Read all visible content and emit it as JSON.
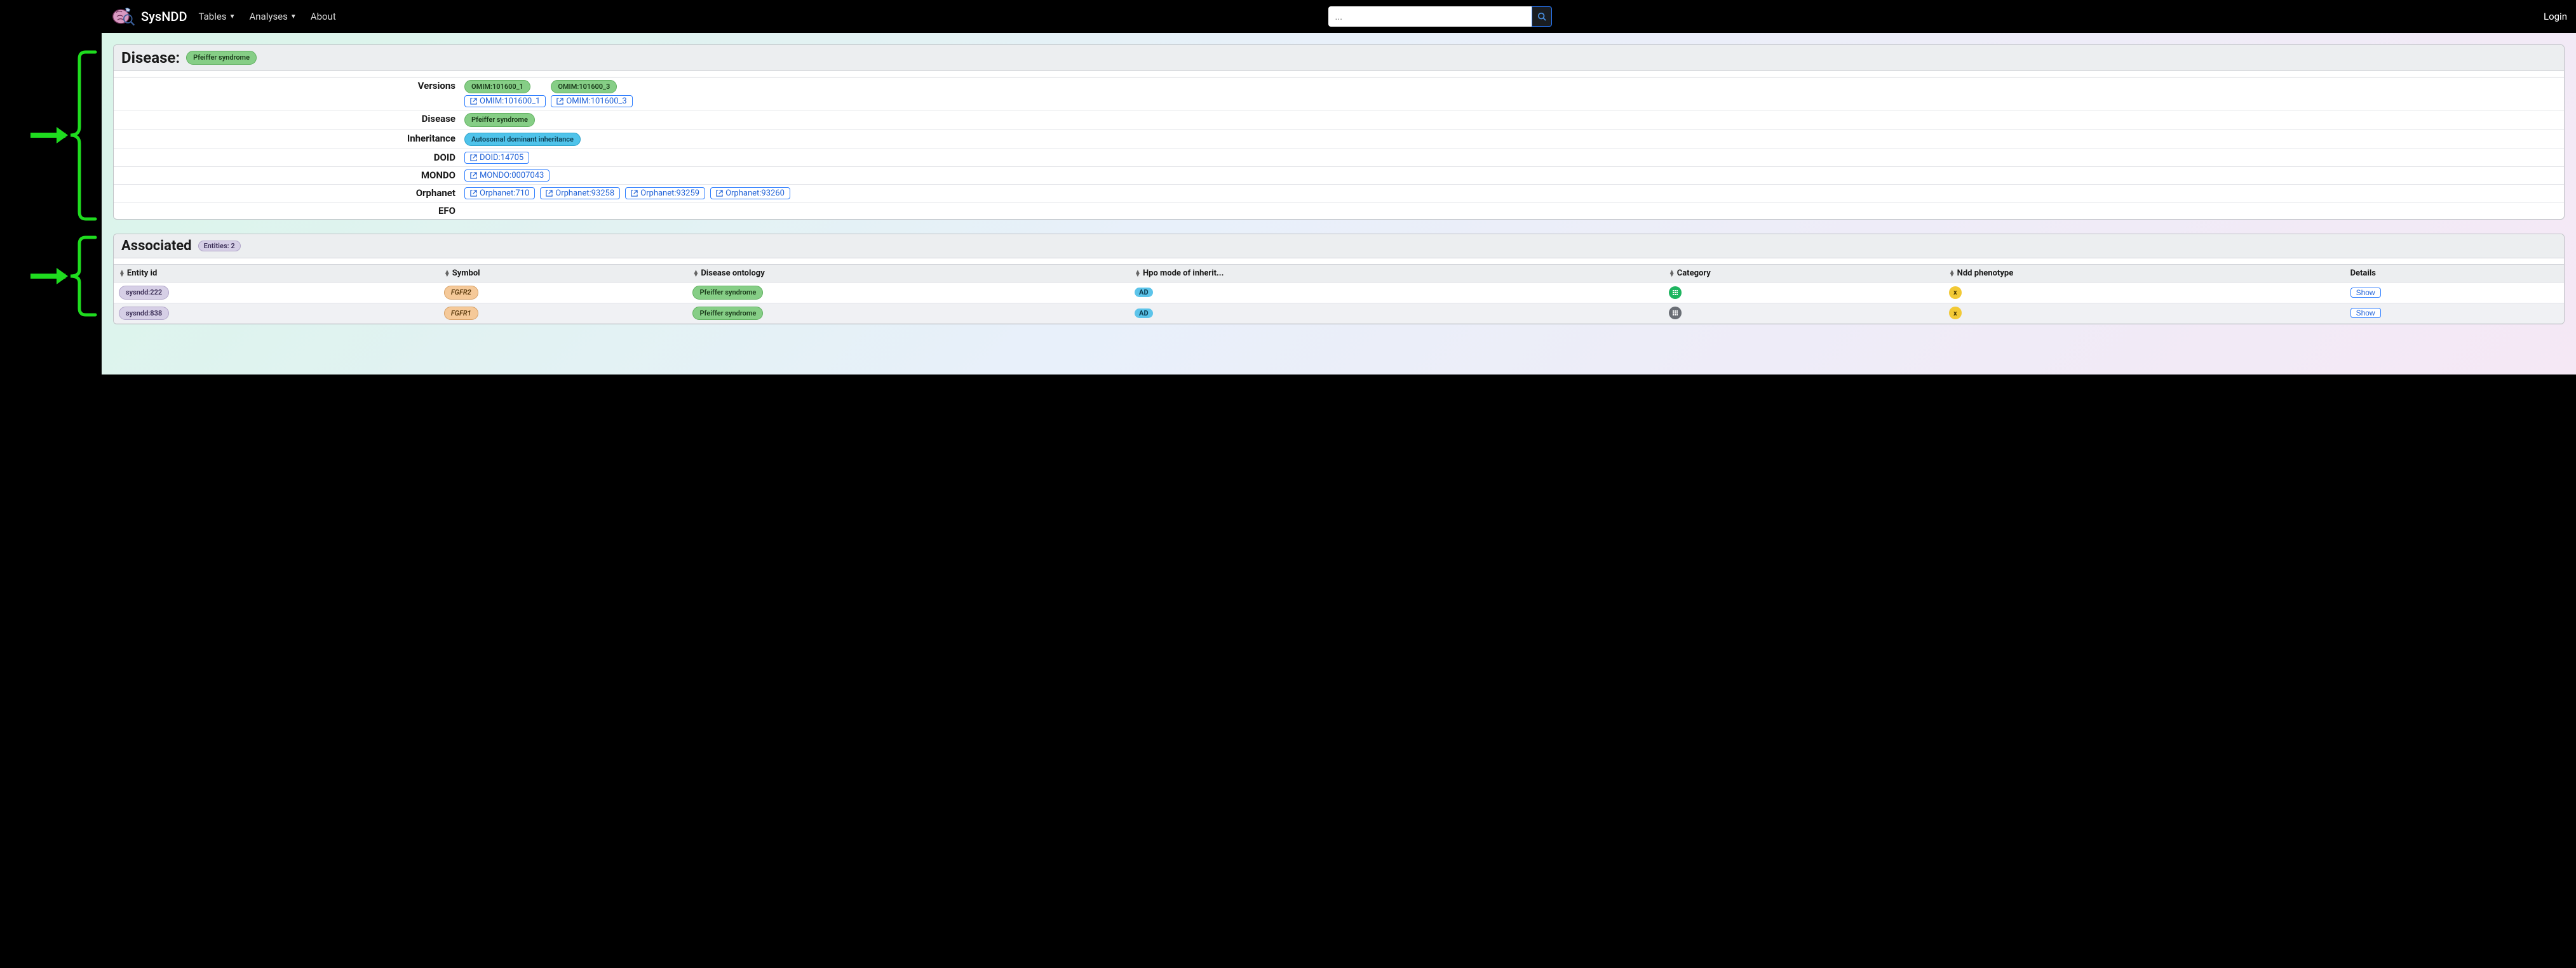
{
  "nav": {
    "brand": "SysNDD",
    "items": [
      "Tables",
      "Analyses",
      "About"
    ],
    "search_placeholder": "...",
    "login": "Login"
  },
  "disease_card": {
    "title": "Disease:",
    "title_pill": "Pfeiffer syndrome",
    "rows": {
      "versions": {
        "label": "Versions",
        "badges": [
          "OMIM:101600_1",
          "OMIM:101600_3"
        ],
        "links": [
          "OMIM:101600_1",
          "OMIM:101600_3"
        ]
      },
      "disease": {
        "label": "Disease",
        "value": "Pfeiffer syndrome"
      },
      "inheritance": {
        "label": "Inheritance",
        "value": "Autosomal dominant inheritance"
      },
      "doid": {
        "label": "DOID",
        "links": [
          "DOID:14705"
        ]
      },
      "mondo": {
        "label": "MONDO",
        "links": [
          "MONDO:0007043"
        ]
      },
      "orphanet": {
        "label": "Orphanet",
        "links": [
          "Orphanet:710",
          "Orphanet:93258",
          "Orphanet:93259",
          "Orphanet:93260"
        ]
      },
      "efo": {
        "label": "EFO"
      }
    }
  },
  "associated_card": {
    "title": "Associated",
    "entities_badge": "Entities: 2",
    "columns": {
      "entity": "Entity id",
      "symbol": "Symbol",
      "ontology": "Disease ontology",
      "hpo": "Hpo mode of inherit...",
      "category": "Category",
      "ndd": "Ndd phenotype",
      "details": "Details"
    },
    "rows": [
      {
        "entity": "sysndd:222",
        "symbol": "FGFR2",
        "ontology": "Pfeiffer syndrome",
        "hpo": "AD",
        "cat_color": "green",
        "ndd": "x",
        "details": "Show"
      },
      {
        "entity": "sysndd:838",
        "symbol": "FGFR1",
        "ontology": "Pfeiffer syndrome",
        "hpo": "AD",
        "cat_color": "gray",
        "ndd": "x",
        "details": "Show"
      }
    ]
  }
}
